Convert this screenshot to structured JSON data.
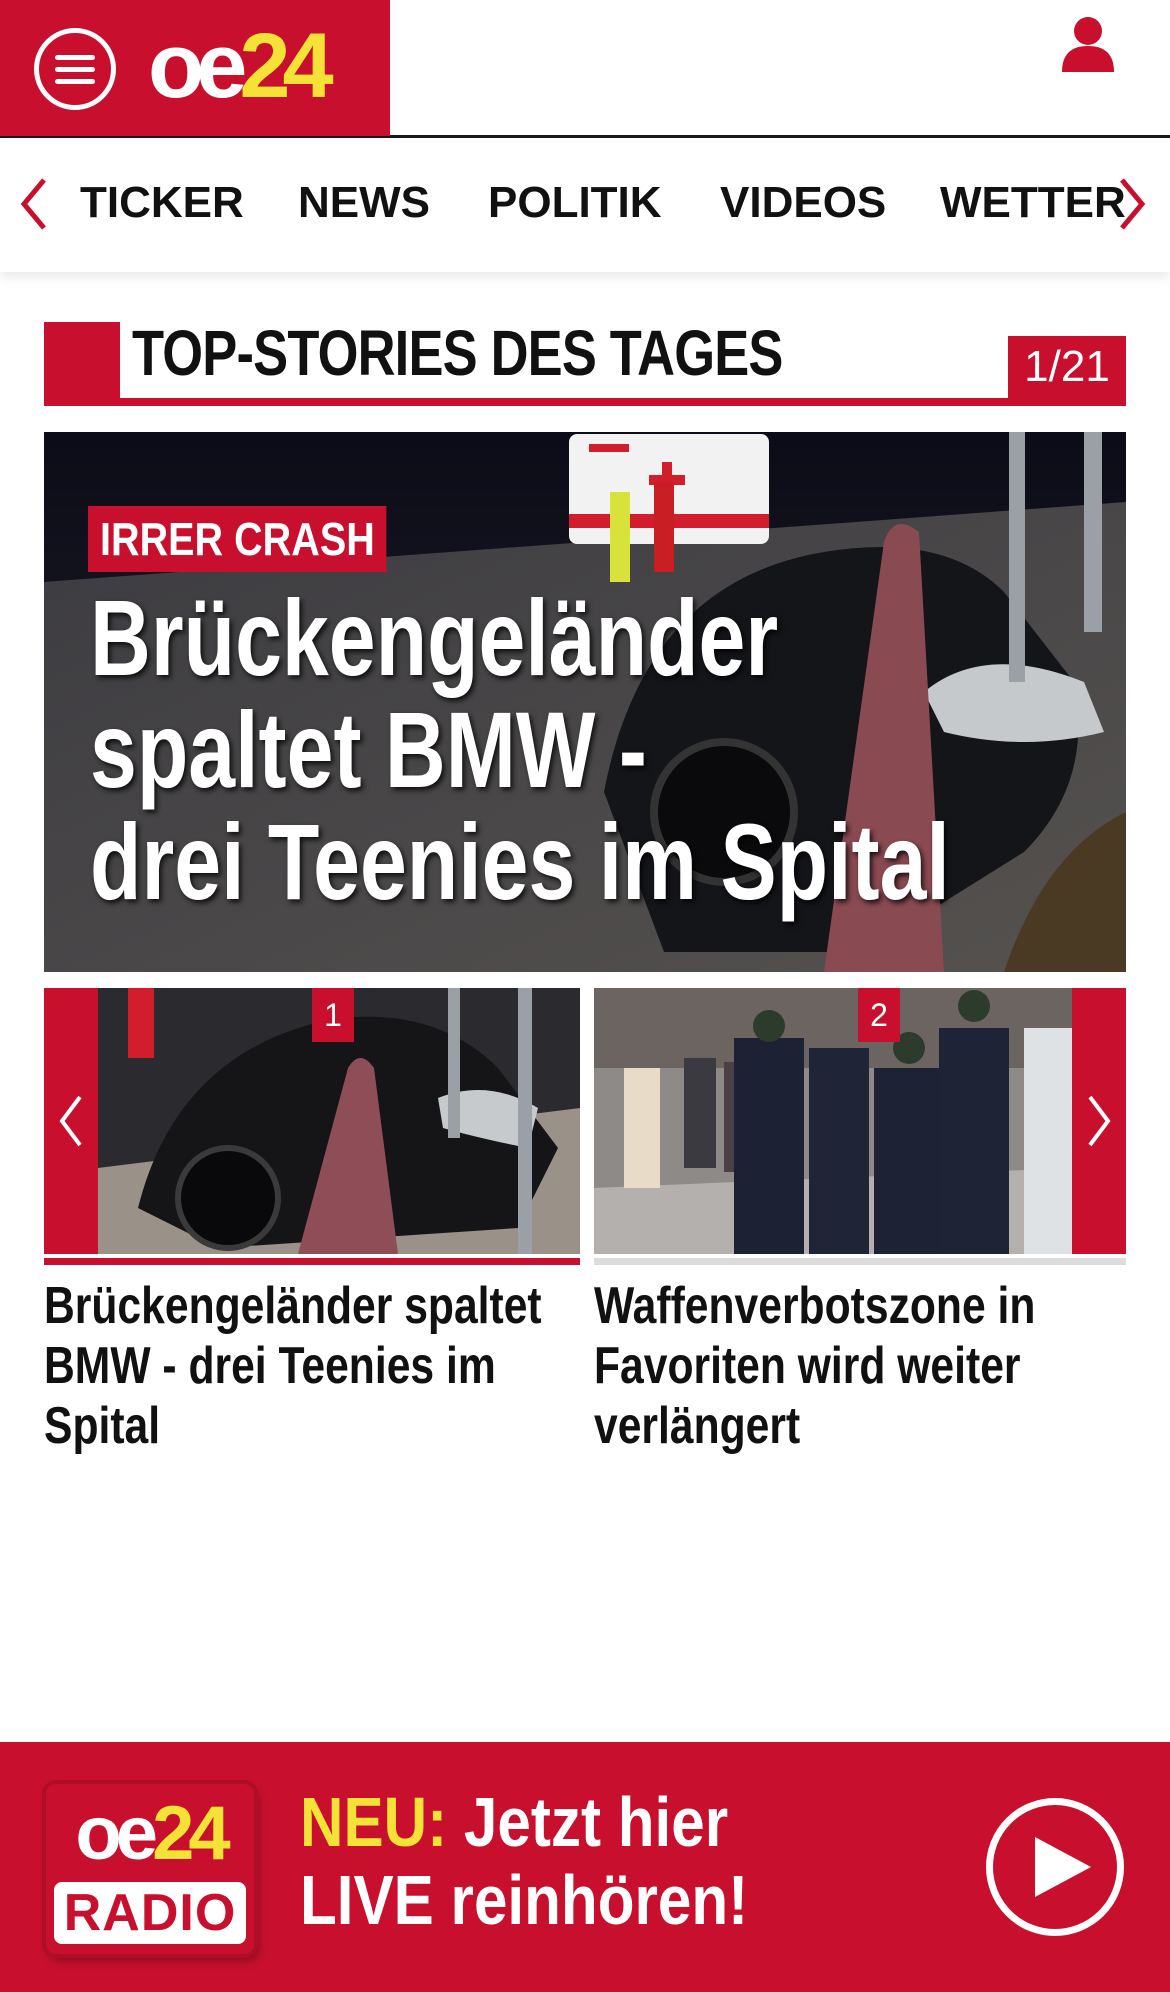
{
  "header": {
    "logo_oe": "oe",
    "logo_num": "24",
    "brand_color": "#c8102e",
    "accent_color": "#f5e236",
    "menu_icon": "hamburger-icon",
    "user_icon": "user-icon"
  },
  "nav": {
    "items": [
      "TICKER",
      "NEWS",
      "POLITIK",
      "VIDEOS",
      "WETTER"
    ],
    "prev_icon": "chevron-left-icon",
    "next_icon": "chevron-right-icon"
  },
  "section": {
    "title": "TOP-STORIES DES TAGES",
    "counter": "1/21"
  },
  "hero": {
    "kicker": "IRRER CRASH",
    "title_lines": [
      "Brückengeländer",
      "spaltet BMW -",
      "drei Teenies im Spital"
    ]
  },
  "carousel": {
    "items": [
      {
        "badge": "1",
        "title": "Brückengeländer spaltet BMW - drei Teenies im Spital"
      },
      {
        "badge": "2",
        "title": "Waffenverbotszone in Favoriten wird weiter verlängert"
      }
    ],
    "prev_icon": "chevron-left-icon",
    "next_icon": "chevron-right-icon"
  },
  "radio_banner": {
    "logo_oe": "oe",
    "logo_num": "24",
    "logo_label": "RADIO",
    "neu": "NEU:",
    "line1_rest": " Jetzt hier",
    "line2": "LIVE reinhören!",
    "play_icon": "play-icon"
  }
}
